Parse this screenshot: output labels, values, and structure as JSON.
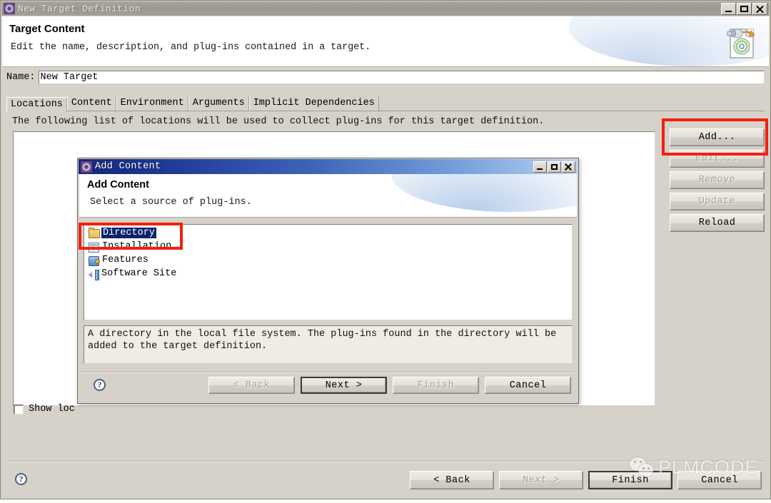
{
  "outer_window": {
    "title": "New Target Definition",
    "title_icon": "gear-target-icon",
    "window_controls": {
      "minimize": "minimize-icon",
      "maximize": "maximize-icon",
      "close": "close-icon"
    },
    "banner": {
      "title": "Target Content",
      "description": "Edit the name, description, and plug-ins contained in a target.",
      "icon": "target-definition-icon"
    },
    "name_field": {
      "label": "Name:",
      "value": "New Target",
      "placeholder": ""
    },
    "tabs": [
      {
        "label": "Locations",
        "active": true
      },
      {
        "label": "Content",
        "active": false
      },
      {
        "label": "Environment",
        "active": false
      },
      {
        "label": "Arguments",
        "active": false
      },
      {
        "label": "Implicit Dependencies",
        "active": false
      }
    ],
    "locations_description": "The following list of locations will be used to collect plug-ins for this target definition.",
    "side_buttons": [
      {
        "label": "Add...",
        "enabled": true
      },
      {
        "label": "Edit...",
        "enabled": false
      },
      {
        "label": "Remove",
        "enabled": false
      },
      {
        "label": "Update",
        "enabled": false
      },
      {
        "label": "Reload",
        "enabled": true
      }
    ],
    "show_locations_checkbox": {
      "label": "Show loc",
      "checked": false
    },
    "help_glyph": "?",
    "bottom_buttons": [
      {
        "label": "< Back",
        "enabled": true,
        "default": false
      },
      {
        "label": "Next >",
        "enabled": false,
        "default": false
      },
      {
        "label": "Finish",
        "enabled": true,
        "default": true
      },
      {
        "label": "Cancel",
        "enabled": true,
        "default": false
      }
    ]
  },
  "inner_dialog": {
    "title": "Add Content",
    "title_icon": "gear-target-icon",
    "window_controls": {
      "minimize": "minimize-icon",
      "maximize": "maximize-icon",
      "close": "close-icon"
    },
    "banner": {
      "title": "Add Content",
      "description": "Select a source of plug-ins."
    },
    "source_list": [
      {
        "label": "Directory",
        "icon": "folder-icon",
        "selected": true
      },
      {
        "label": "Installation",
        "icon": "installation-icon",
        "selected": false
      },
      {
        "label": "Features",
        "icon": "features-puzzle-icon",
        "selected": false
      },
      {
        "label": "Software Site",
        "icon": "software-site-plug-icon",
        "selected": false
      }
    ],
    "selection_description": "A directory in the local file system. The plug-ins found in the directory will be added to the target definition.",
    "help_glyph": "?",
    "buttons": [
      {
        "label": "< Back",
        "enabled": false,
        "default": false
      },
      {
        "label": "Next >",
        "enabled": true,
        "default": true
      },
      {
        "label": "Finish",
        "enabled": false,
        "default": false
      },
      {
        "label": "Cancel",
        "enabled": true,
        "default": false
      }
    ]
  },
  "annotations": {
    "highlight_color": "#f41f0f",
    "boxes": [
      {
        "name": "add-button-highlight",
        "target": "Add..."
      },
      {
        "name": "directory-item-highlight",
        "target": "Directory"
      }
    ]
  },
  "watermark": {
    "text": "PLMCODE",
    "icon": "wechat-icon"
  }
}
